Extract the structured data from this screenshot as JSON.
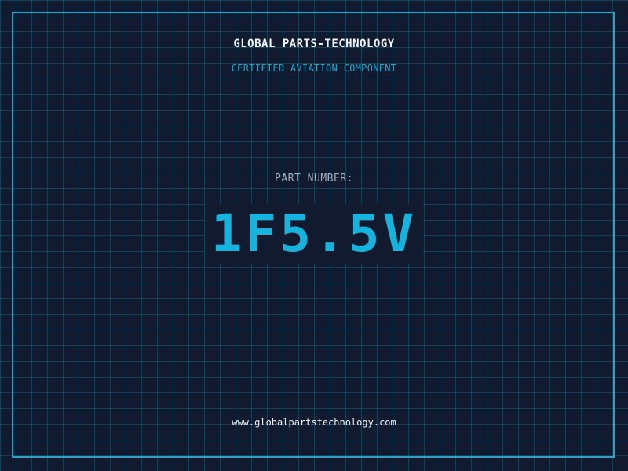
{
  "header": {
    "company": "GLOBAL PARTS-TECHNOLOGY",
    "subtitle": "CERTIFIED AVIATION COMPONENT"
  },
  "part": {
    "label": "PART NUMBER:",
    "number": "1F5.5V"
  },
  "footer": {
    "website": "www.globalpartstechnology.com"
  },
  "colors": {
    "background": "#111a2e",
    "grid": "#14a0c8",
    "accent": "#17b3dc",
    "text": "#f2f5fa",
    "muted": "#a6adba"
  }
}
